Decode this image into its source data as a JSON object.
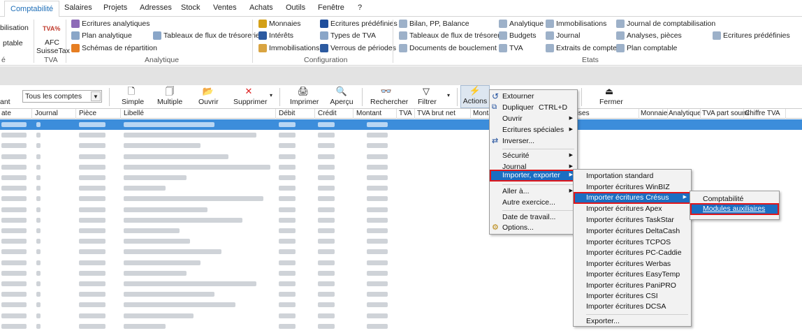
{
  "tabs": [
    "Comptabilité",
    "Salaires",
    "Projets",
    "Adresses",
    "Stock",
    "Ventes",
    "Achats",
    "Outils",
    "Fenêtre",
    "?"
  ],
  "ribbon": {
    "left_cut": [
      "bilisation",
      "ptable",
      "é"
    ],
    "tva_icon": "TVA%",
    "tva_label1": "AFC",
    "tva_label2": "SuisseTax",
    "tva_group": "TVA",
    "analytique": {
      "items": [
        "Ecritures analytiques",
        "Plan analytique",
        "Schémas de répartition",
        "Tableaux de flux de trésorerie"
      ],
      "group": "Analytique"
    },
    "configuration": {
      "items": [
        "Monnaies",
        "Intérêts",
        "Immobilisations",
        "Ecritures prédéfinies",
        "Types de TVA",
        "Verrous de périodes"
      ],
      "group": "Configuration"
    },
    "etats": {
      "items": [
        "Bilan, PP, Balance",
        "Tableaux de flux de trésorerie",
        "Documents de bouclement",
        "Analytique",
        "Budgets",
        "TVA",
        "Immobilisations",
        "Journal",
        "Extraits de comptes",
        "Journal de comptabilisation",
        "Analyses, pièces",
        "Plan comptable",
        "Ecritures prédéfinies"
      ],
      "group": "Etats"
    }
  },
  "toolbar": {
    "left_cut": "ant",
    "account_select": "Tous les comptes",
    "buttons": [
      "Simple",
      "Multiple",
      "Ouvrir",
      "Supprimer",
      "Imprimer",
      "Aperçu",
      "Rechercher",
      "Filtrer",
      "Actions",
      "Fermer"
    ]
  },
  "columns_left": [
    "ate",
    "Journal",
    "Pièce",
    "Libellé",
    "Débit",
    "Crédit",
    "Montant",
    "TVA",
    "TVA brut net",
    "Monta"
  ],
  "columns_right": [
    "Devises",
    "Monnaie",
    "Analytique",
    "TVA part soumi",
    "Chiffre TVA"
  ],
  "actions_menu": {
    "items": [
      {
        "label": "Extourner",
        "icon": "undo-icon"
      },
      {
        "label": "Dupliquer",
        "shortcut": "CTRL+D",
        "icon": "copy-icon"
      },
      {
        "label": "Ouvrir",
        "sub": true
      },
      {
        "label": "Ecritures spéciales",
        "sub": true
      },
      {
        "label": "Inverser...",
        "icon": "swap-icon"
      },
      {
        "label": "Sécurité",
        "sub": true
      },
      {
        "label": "Journal",
        "sub": true
      },
      {
        "label": "Importer, exporter",
        "sub": true,
        "highlighted": true
      },
      {
        "label": "Aller à...",
        "sub": true
      },
      {
        "label": "Autre exercice..."
      },
      {
        "label": "Date de travail..."
      },
      {
        "label": "Options...",
        "icon": "options-icon"
      }
    ]
  },
  "import_menu": {
    "items": [
      "Importation standard",
      "Importer écritures WinBIZ",
      "Importer écritures Crésus",
      "Importer écritures Apex",
      "Importer écritures TaskStar",
      "Importer écritures DeltaCash",
      "Importer écritures TCPOS",
      "Importer écritures PC-Caddie",
      "Importer écritures Werbas",
      "Importer écritures EasyTemp",
      "Importer écritures PaniPRO",
      "Importer écritures CSI",
      "Importer écritures DCSA",
      "Exporter..."
    ],
    "highlighted": "Importer écritures Crésus"
  },
  "cresus_menu": {
    "items": [
      "Comptabilité",
      "Modules auxiliaires"
    ],
    "highlighted": "Modules auxiliaires"
  },
  "colors": {
    "accent": "#1f6fb8",
    "selection": "#3c8ddb",
    "menu_highlight": "#1b6ec2",
    "annotation_red": "#e0161b"
  }
}
